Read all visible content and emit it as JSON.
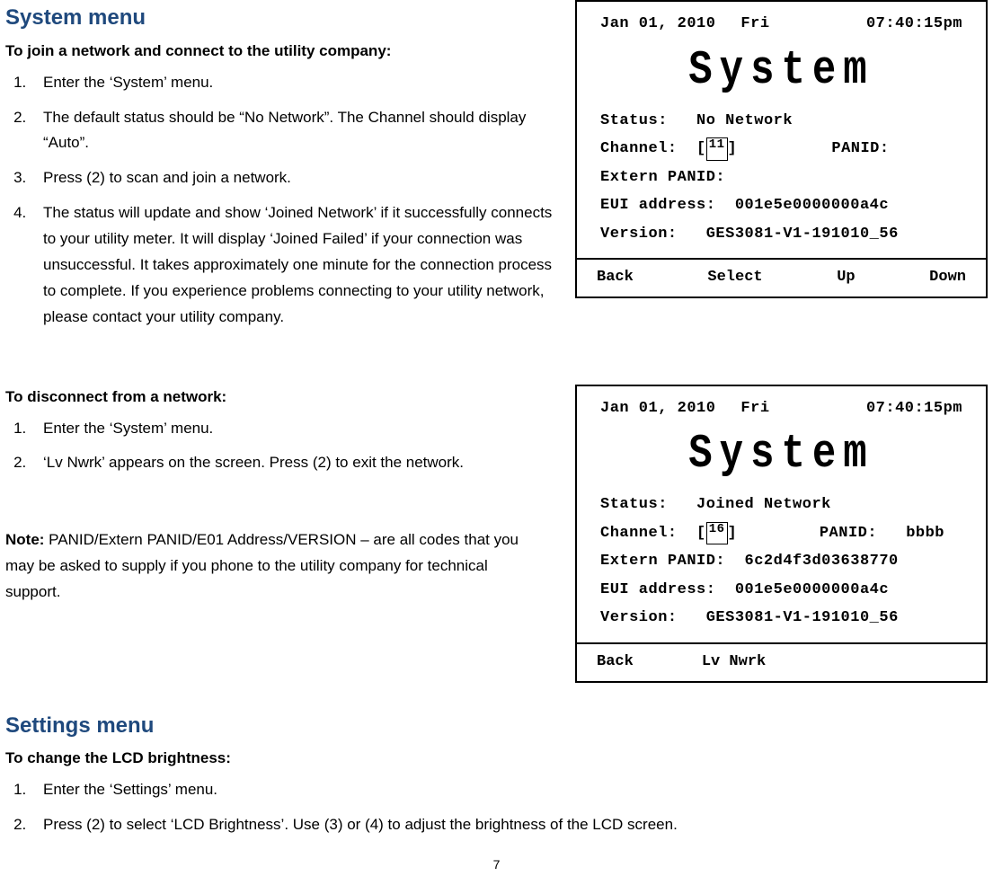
{
  "system_menu": {
    "title": "System menu",
    "join": {
      "heading": "To join a network and connect to the utility company:",
      "step1": "Enter the ‘System’ menu.",
      "step2": "The default status should be “No Network”.  The Channel should display “Auto”.",
      "step3": "Press (2) to scan and join a network.",
      "step4": "The status will update and show ‘Joined Network’ if it successfully connects to your utility meter.  It will display ‘Joined Failed’ if your connection was unsuccessful.  It takes approximately one minute for the connection process to complete. If you experience problems connecting to your utility network, please contact your utility company."
    },
    "disconnect": {
      "heading": "To disconnect from a network:",
      "step1": "Enter the ‘System’ menu.",
      "step2": "‘Lv Nwrk’ appears on the screen.  Press (2) to exit the network."
    },
    "note_label": "Note:",
    "note_text": " PANID/Extern PANID/E01 Address/VERSION – are all codes that you may be asked to supply if you phone to the utility company for technical support."
  },
  "settings_menu": {
    "title": "Settings menu",
    "brightness": {
      "heading": "To change the LCD brightness:",
      "step1": "Enter the ‘Settings’ menu.",
      "step2": "Press (2) to select ‘LCD Brightness’.  Use (3) or (4) to adjust the brightness of the LCD screen."
    }
  },
  "lcd1": {
    "date": "Jan 01, 2010",
    "day": "Fri",
    "time": "07:40:15pm",
    "title": "System",
    "status_label": "Status:",
    "status_value": "No Network",
    "channel_label": "Channel:",
    "channel_value": "11",
    "panid_label": "PANID:",
    "panid_value": "",
    "ext_panid_label": "Extern PANID:",
    "ext_panid_value": "",
    "eui_label": "EUI  address:",
    "eui_value": "001e5e0000000a4c",
    "version_label": "Version:",
    "version_value": "GES3081-V1-191010_56",
    "footer": {
      "a": "Back",
      "b": "Select",
      "c": "Up",
      "d": "Down"
    }
  },
  "lcd2": {
    "date": "Jan 01, 2010",
    "day": "Fri",
    "time": "07:40:15pm",
    "title": "System",
    "status_label": "Status:",
    "status_value": "Joined Network",
    "channel_label": "Channel:",
    "channel_value": "16",
    "panid_label": "PANID:",
    "panid_value": "bbbb",
    "ext_panid_label": "Extern PANID:",
    "ext_panid_value": "6c2d4f3d03638770",
    "eui_label": "EUI  address:",
    "eui_value": "001e5e0000000a4c",
    "version_label": "Version:",
    "version_value": "GES3081-V1-191010_56",
    "footer": {
      "a": "Back",
      "b": "Lv Nwrk"
    }
  },
  "page_number": "7"
}
